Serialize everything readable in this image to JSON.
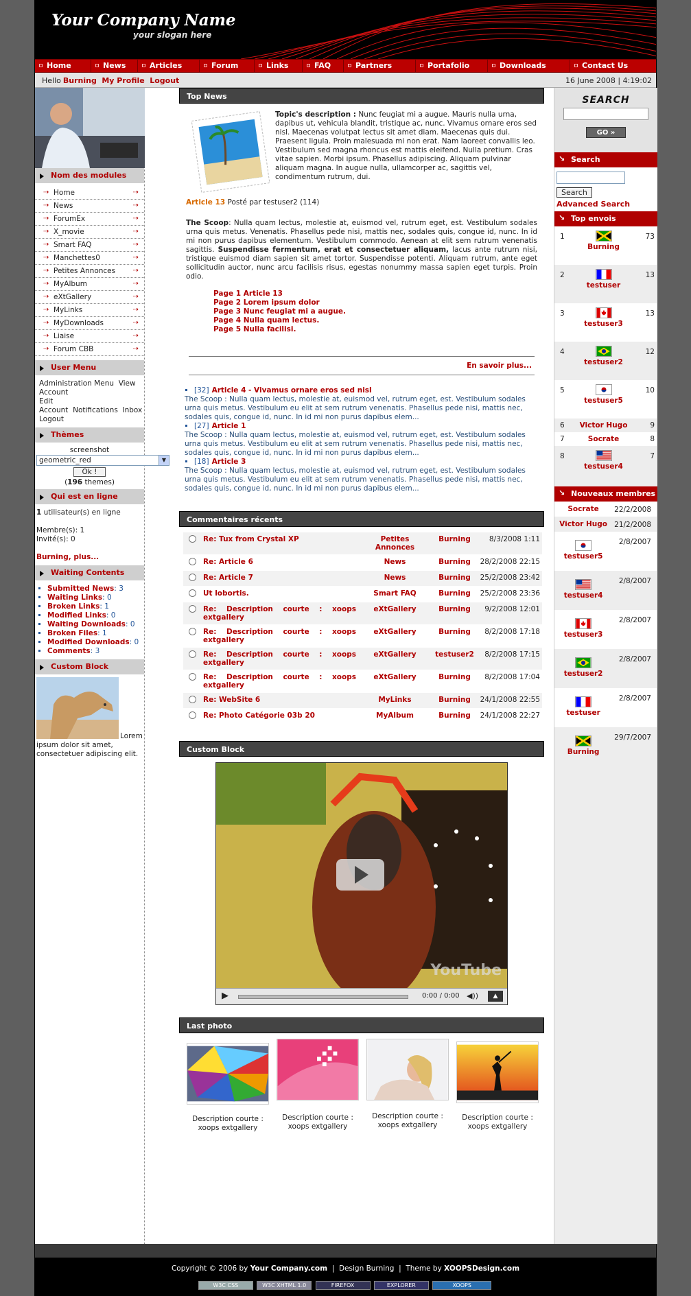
{
  "header": {
    "logo": "Your Company Name",
    "slogan": "your slogan here"
  },
  "nav": [
    "Home",
    "News",
    "Articles",
    "Forum",
    "Links",
    "FAQ",
    "Partners",
    "Portafolio",
    "Downloads",
    "Contact Us"
  ],
  "userbar": {
    "hello": "Hello",
    "username": "Burning",
    "profile": "My Profile",
    "logout": "Logout",
    "datetime": "16 June 2008 | 4:19:02"
  },
  "left": {
    "modules_title": "Nom des modules",
    "modules": [
      "Home",
      "News",
      "ForumEx",
      "X_movie",
      "Smart FAQ",
      "Manchettes0",
      "Petites Annonces",
      "MyAlbum",
      "eXtGallery",
      "MyLinks",
      "MyDownloads",
      "Liaise",
      "Forum CBB"
    ],
    "usermenu_title": "User Menu",
    "usermenu": [
      "Administration Menu",
      "View Account",
      "Edit Account",
      "Notifications",
      "Inbox",
      "Logout"
    ],
    "themes_title": "Thèmes",
    "themes_label": "screenshot",
    "themes_selected": "geometric_red",
    "themes_button": "Ok !",
    "themes_count": "196",
    "themes_count_suffix": "themes",
    "online_title": "Qui est en ligne",
    "online_count": "1",
    "online_text": "utilisateur(s) en ligne",
    "members": "Membre(s): 1",
    "guests": "Invité(s): 0",
    "online_link": "Burning, plus...",
    "waiting_title": "Waiting Contents",
    "waiting": [
      {
        "label": "Submitted News",
        "count": "3"
      },
      {
        "label": "Waiting Links",
        "count": "0"
      },
      {
        "label": "Broken Links",
        "count": "1"
      },
      {
        "label": "Modified Links",
        "count": "0"
      },
      {
        "label": "Waiting Downloads",
        "count": "0"
      },
      {
        "label": "Broken Files",
        "count": "1"
      },
      {
        "label": "Modified Downloads",
        "count": "0"
      },
      {
        "label": "Comments",
        "count": "3"
      }
    ],
    "custom_title": "Custom Block",
    "custom_text": "Lorem ipsum dolor sit amet, consectetuer adipiscing elit."
  },
  "center": {
    "topnews_title": "Top News",
    "topic_label": "Topic's description :",
    "topic_text": "Nunc feugiat mi a augue. Mauris nulla urna, dapibus ut, vehicula blandit, tristique ac, nunc. Vivamus ornare eros sed nisl. Maecenas volutpat lectus sit amet diam. Maecenas quis dui. Praesent ligula. Proin malesuada mi non erat. Nam laoreet convallis leo. Vestibulum sed magna rhoncus est mattis eleifend. Nulla pretium. Cras vitae sapien. Morbi ipsum. Phasellus adipiscing. Aliquam pulvinar aliquam magna. In augue nulla, ullamcorper ac, sagittis vel, condimentum rutrum, dui.",
    "article_title": "Article 13",
    "article_meta": "Posté par testuser2 (114)",
    "scoop_label": "The Scoop",
    "scoop_text1": ": Nulla quam lectus, molestie at, euismod vel, rutrum eget, est. Vestibulum sodales urna quis metus. Venenatis. Phasellus pede nisi, mattis nec, sodales quis, congue id, nunc. In id mi non purus dapibus elementum. Vestibulum commodo. Aenean at elit sem rutrum venenatis sagittis.",
    "scoop_bold": "Suspendisse fermentum, erat et consectetuer aliquam,",
    "scoop_text2": "lacus ante rutrum nisi, tristique euismod diam sapien sit amet tortor. Suspendisse potenti. Aliquam rutrum, ante eget sollicitudin auctor, nunc arcu facilisis risus, egestas nonummy massa sapien eget turpis. Proin odio.",
    "pages": [
      "Page 1 Article 13",
      "Page 2 Lorem ipsum dolor",
      "Page 3 Nunc feugiat mi a augue.",
      "Page 4 Nulla quam lectus.",
      "Page 5 Nulla facilisi."
    ],
    "readmore": "En savoir plus...",
    "news_items": [
      {
        "num": "[32]",
        "title": "Article 4 - Vivamus ornare eros sed nisl",
        "text": "The Scoop : Nulla quam lectus, molestie at, euismod vel, rutrum eget, est. Vestibulum sodales urna quis metus. Vestibulum eu elit at sem rutrum venenatis. Phasellus pede nisi, mattis nec, sodales quis, congue id, nunc. In id mi non purus dapibus elem..."
      },
      {
        "num": "[27]",
        "title": "Article 1",
        "text": "The Scoop : Nulla quam lectus, molestie at, euismod vel, rutrum eget, est. Vestibulum sodales urna quis metus. Vestibulum eu elit at sem rutrum venenatis. Phasellus pede nisi, mattis nec, sodales quis, congue id, nunc. In id mi non purus dapibus elem..."
      },
      {
        "num": "[18]",
        "title": "Article 3",
        "text": "The Scoop : Nulla quam lectus, molestie at, euismod vel, rutrum eget, est. Vestibulum sodales urna quis metus. Vestibulum eu elit at sem rutrum venenatis. Phasellus pede nisi, mattis nec, sodales quis, congue id, nunc. In id mi non purus dapibus elem..."
      }
    ],
    "comments_title": "Commentaires récents",
    "comments": [
      {
        "title": "Re: Tux from Crystal XP",
        "module": "Petites Annonces",
        "user": "Burning",
        "date": "8/3/2008 1:11"
      },
      {
        "title": "Re: Article 6",
        "module": "News",
        "user": "Burning",
        "date": "28/2/2008 22:15"
      },
      {
        "title": "Re: Article 7",
        "module": "News",
        "user": "Burning",
        "date": "25/2/2008 23:42"
      },
      {
        "title": "Ut lobortis.",
        "module": "Smart FAQ",
        "user": "Burning",
        "date": "25/2/2008 23:36"
      },
      {
        "title": "Re: Description courte : xoops extgallery",
        "module": "eXtGallery",
        "user": "Burning",
        "date": "9/2/2008 12:01"
      },
      {
        "title": "Re: Description courte : xoops extgallery",
        "module": "eXtGallery",
        "user": "Burning",
        "date": "8/2/2008 17:18"
      },
      {
        "title": "Re: Description courte : xoops extgallery",
        "module": "eXtGallery",
        "user": "testuser2",
        "date": "8/2/2008 17:15"
      },
      {
        "title": "Re: Description courte : xoops extgallery",
        "module": "eXtGallery",
        "user": "Burning",
        "date": "8/2/2008 17:04"
      },
      {
        "title": "Re: WebSite 6",
        "module": "MyLinks",
        "user": "Burning",
        "date": "24/1/2008 22:55"
      },
      {
        "title": "Re: Photo Catégorie 03b 20",
        "module": "MyAlbum",
        "user": "Burning",
        "date": "24/1/2008 22:27"
      }
    ],
    "custom_title": "Custom Block",
    "video_time": "0:00 / 0:00",
    "video_brand": "YouTube",
    "lastphoto_title": "Last photo",
    "photos": [
      "Description courte : xoops extgallery",
      "Description courte : xoops extgallery",
      "Description courte : xoops extgallery",
      "Description courte : xoops extgallery"
    ]
  },
  "right": {
    "search_graphic": "SEARCH",
    "go": "GO",
    "search_title": "Search",
    "search_button": "Search",
    "advanced": "Advanced Search",
    "top_title": "Top envois",
    "top": [
      {
        "rank": "1",
        "user": "Burning",
        "count": "73",
        "flag": "jamaica"
      },
      {
        "rank": "2",
        "user": "testuser",
        "count": "13",
        "flag": "france"
      },
      {
        "rank": "3",
        "user": "testuser3",
        "count": "13",
        "flag": "canada"
      },
      {
        "rank": "4",
        "user": "testuser2",
        "count": "12",
        "flag": "brazil"
      },
      {
        "rank": "5",
        "user": "testuser5",
        "count": "10",
        "flag": "korea"
      },
      {
        "rank": "6",
        "user": "Victor Hugo",
        "count": "9",
        "flag": ""
      },
      {
        "rank": "7",
        "user": "Socrate",
        "count": "8",
        "flag": ""
      },
      {
        "rank": "8",
        "user": "testuser4",
        "count": "7",
        "flag": "usa"
      }
    ],
    "new_title": "Nouveaux membres",
    "new": [
      {
        "user": "Socrate",
        "date": "22/2/2008",
        "flag": ""
      },
      {
        "user": "Victor Hugo",
        "date": "21/2/2008",
        "flag": ""
      },
      {
        "user": "testuser5",
        "date": "2/8/2007",
        "flag": "korea"
      },
      {
        "user": "testuser4",
        "date": "2/8/2007",
        "flag": "usa"
      },
      {
        "user": "testuser3",
        "date": "2/8/2007",
        "flag": "canada"
      },
      {
        "user": "testuser2",
        "date": "2/8/2007",
        "flag": "brazil"
      },
      {
        "user": "testuser",
        "date": "2/8/2007",
        "flag": "france"
      },
      {
        "user": "Burning",
        "date": "29/7/2007",
        "flag": "jamaica"
      }
    ]
  },
  "footer": {
    "copy_prefix": "Copyright © 2006 by",
    "company": "Your Company.com",
    "design": "Design Burning",
    "theme_prefix": "Theme by",
    "theme_by": "XOOPSDesign.com",
    "badges": [
      "W3C CSS",
      "W3C XHTML 1.0",
      "FIREFOX",
      "EXPLORER",
      "XOOPS"
    ]
  }
}
